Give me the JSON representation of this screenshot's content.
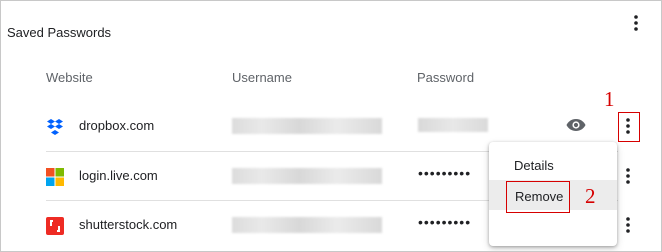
{
  "section": {
    "title": "Saved Passwords",
    "more_icon": "vertical-dots-icon"
  },
  "columns": {
    "website": "Website",
    "username": "Username",
    "password": "Password"
  },
  "rows": [
    {
      "site": "dropbox.com",
      "icon": "dropbox-logo-icon",
      "username_hidden": true,
      "password_display": "",
      "password_masked": true
    },
    {
      "site": "login.live.com",
      "icon": "microsoft-logo-icon",
      "username_hidden": true,
      "password_display": "•••••••••"
    },
    {
      "site": "shutterstock.com",
      "icon": "shutterstock-logo-icon",
      "username_hidden": true,
      "password_display": "•••••••••"
    }
  ],
  "context_menu": {
    "items": [
      "Details",
      "Remove"
    ],
    "highlighted": "Remove"
  },
  "annotations": {
    "step1": "1",
    "step2": "2",
    "color": "#d60000"
  },
  "colors": {
    "text": "#202124",
    "muted": "#5f6368",
    "divider": "#e0e0e0",
    "dropbox": "#0061fe",
    "shutterstock": "#ee2b24"
  }
}
